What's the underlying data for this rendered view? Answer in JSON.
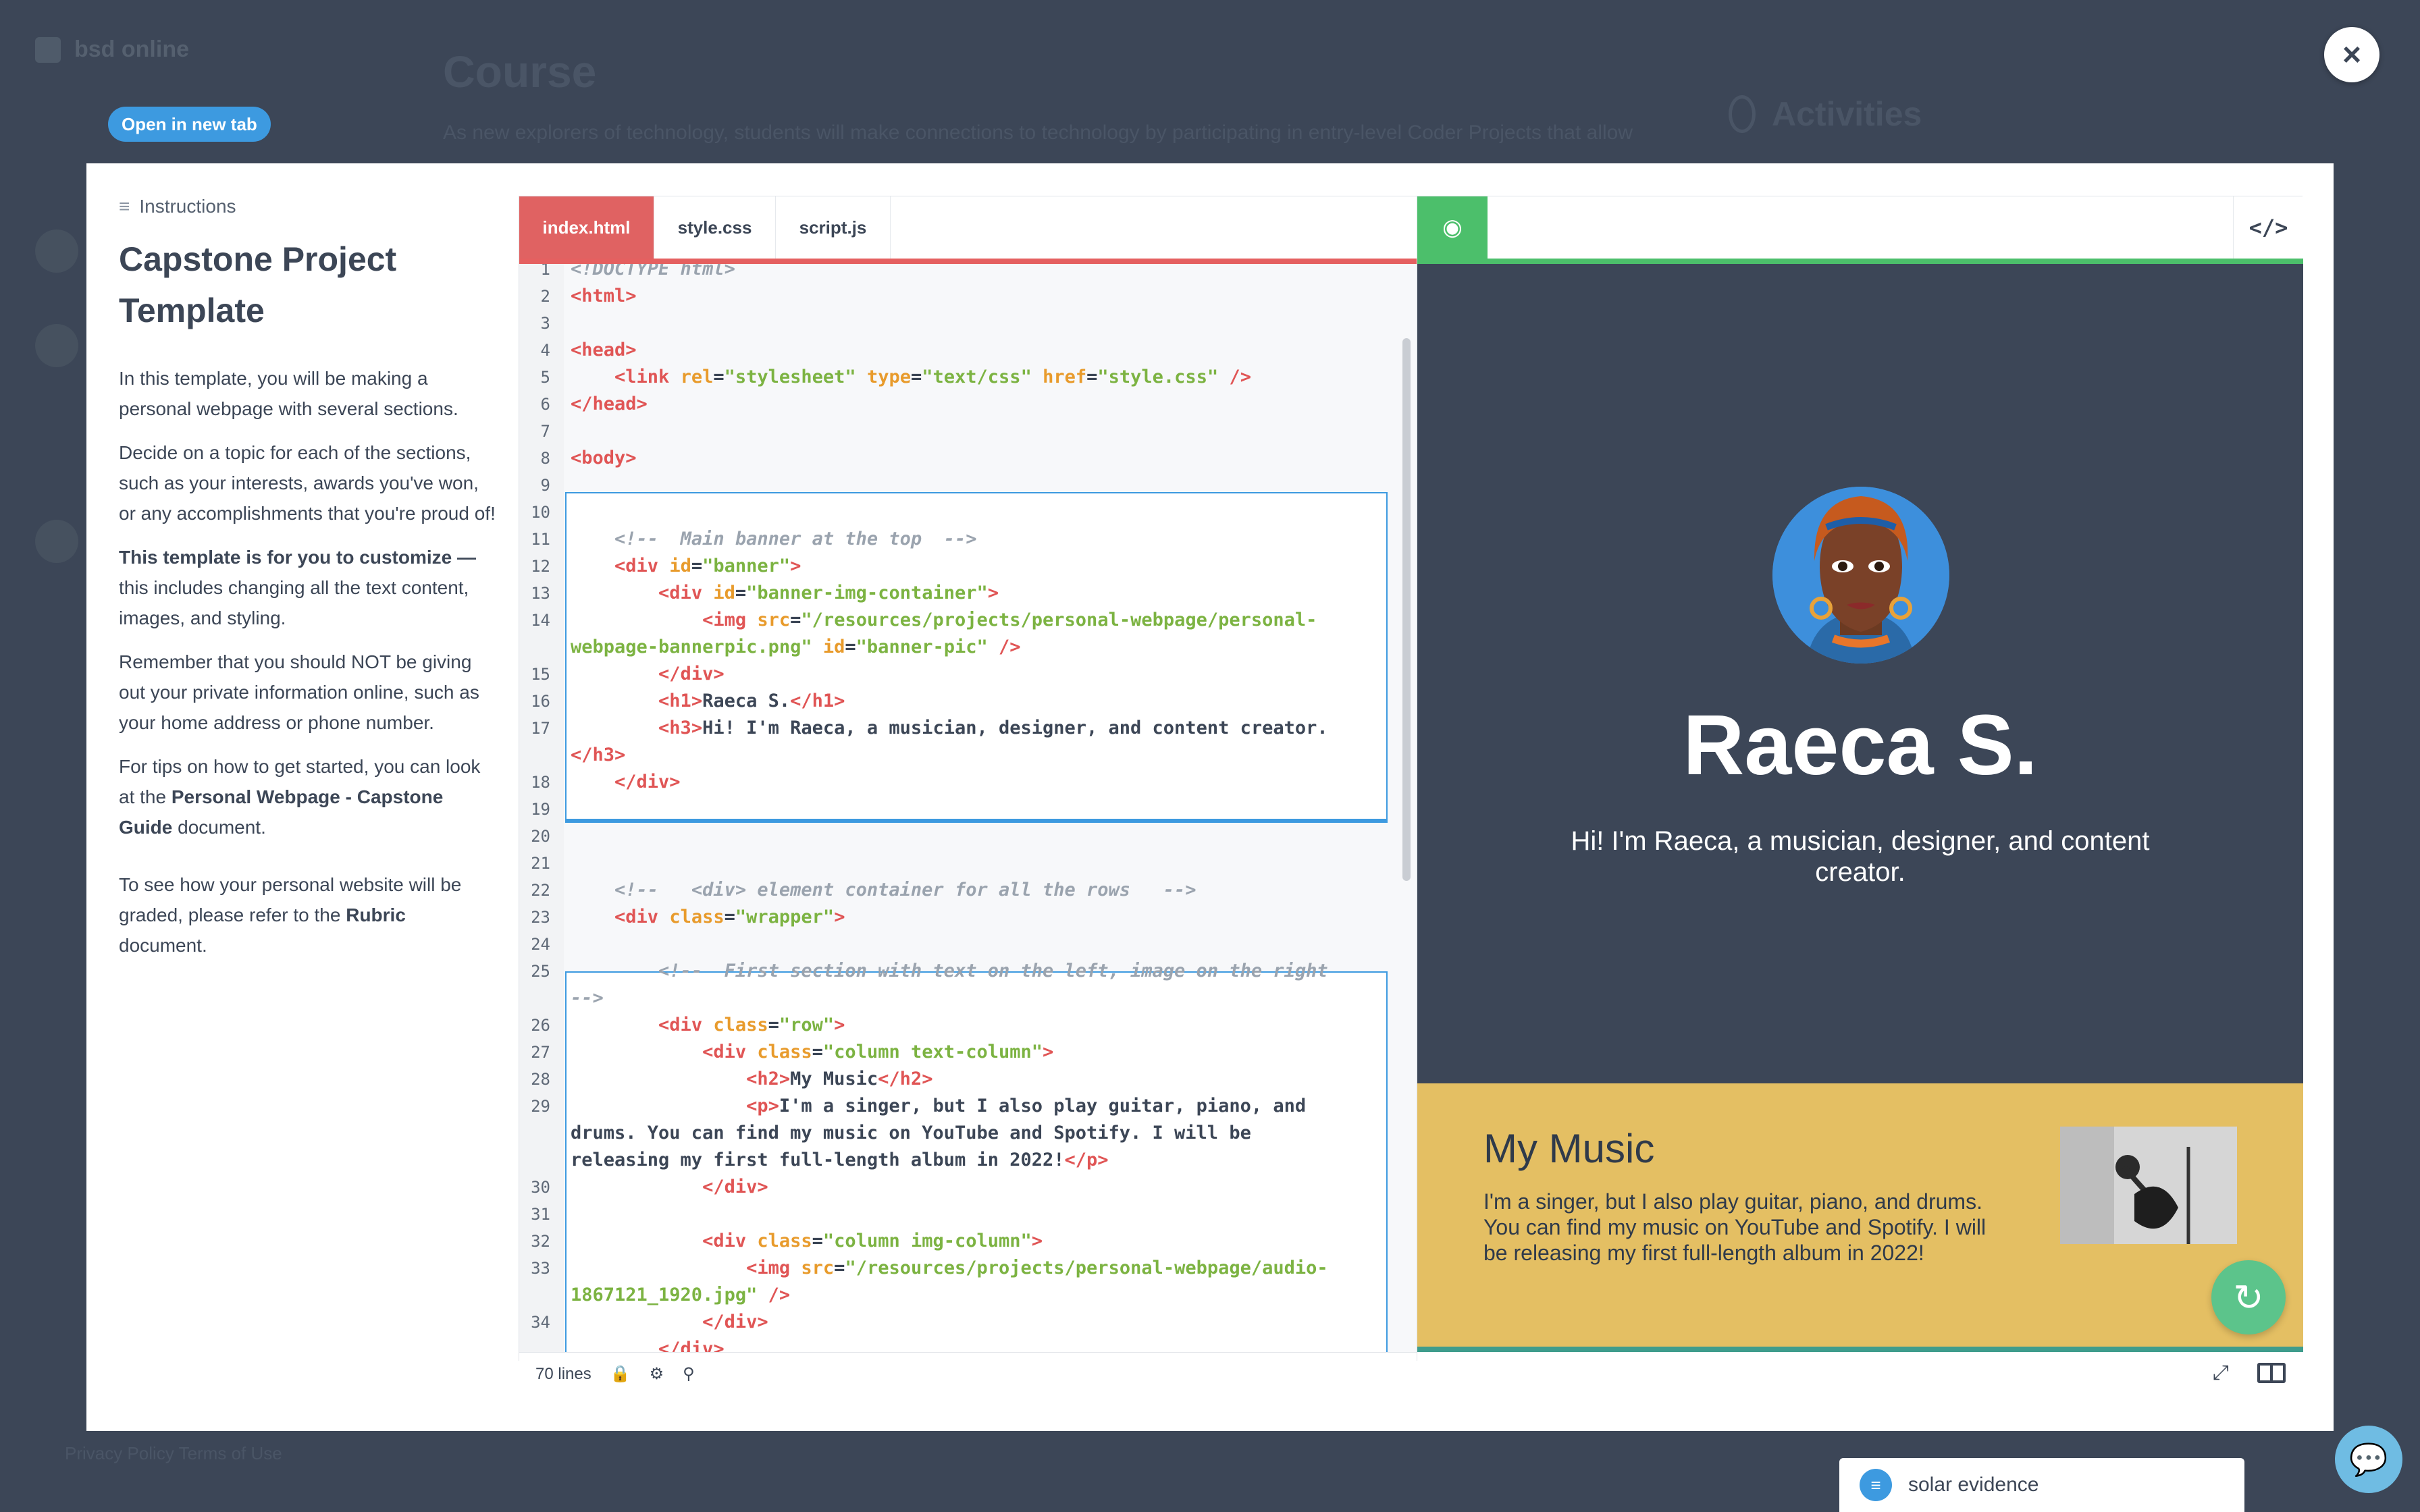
{
  "background": {
    "brand": "bsd online",
    "title": "Course",
    "paragraph": "As new explorers of technology, students will make connections to technology by participating in entry-level Coder Projects that allow",
    "activities": "Activities",
    "footer": "Privacy Policy   Terms of Use"
  },
  "open_tab_label": "Open in new tab",
  "close_label": "×",
  "instructions": {
    "header": "Instructions",
    "title": "Capstone Project Template",
    "p1": "In this template, you will be making a personal webpage with several sections.",
    "p2": "Decide on a topic for each of the sections, such as your interests, awards you've won, or any accomplishments that you're proud of!",
    "p3_bold": "This template is for you to customize —",
    "p3_rest": " this includes changing all the text content, images, and styling.",
    "p4": "Remember that you should NOT be giving out your private information online, such as your home address or phone number.",
    "p5_a": "For tips on how to get started, you can look at the ",
    "p5_bold": "Personal Webpage - Capstone Guide",
    "p5_b": " document.",
    "p6_a": "To see how your personal website will be graded, please refer to the ",
    "p6_bold": "Rubric",
    "p6_b": " document."
  },
  "editor": {
    "tabs": [
      "index.html",
      "style.css",
      "script.js"
    ],
    "active_tab": "index.html",
    "line_count": "70 lines"
  },
  "preview": {
    "name": "Raeca S.",
    "subtitle": "Hi! I'm Raeca, a musician, designer, and content creator.",
    "music_title": "My Music",
    "music_text": "I'm a singer, but I also play guitar, piano, and drums. You can find my music on YouTube and Spotify. I will be releasing my first full-length album in 2022!"
  },
  "chat": {
    "label": "solar evidence"
  },
  "icons": {
    "instructions": "instructions-icon",
    "eye": "eye-icon",
    "code": "code-icon",
    "refresh": "refresh-icon",
    "lock": "lock-icon",
    "bug": "bug-icon",
    "search": "search-icon",
    "fullscreen": "fullscreen-icon",
    "split": "split-view-icon",
    "chat": "chat-icon"
  },
  "colors": {
    "tab_accent": "#e06262",
    "preview_accent": "#4cbf6b",
    "banner_bg": "#3c4657",
    "music_bg": "#e4bf63"
  }
}
